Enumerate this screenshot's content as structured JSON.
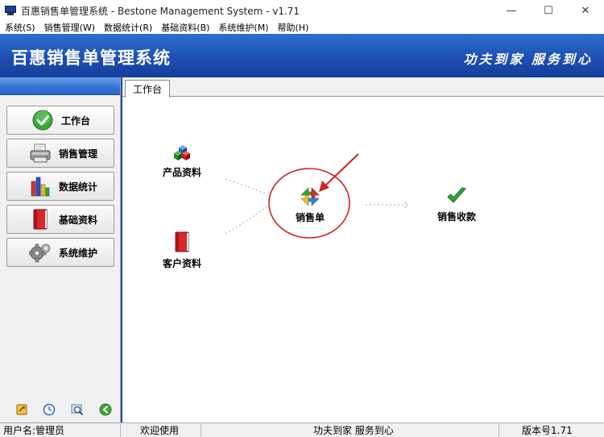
{
  "window": {
    "title": "百惠销售单管理系统 - Bestone Management System - v1.71",
    "minimize": "—",
    "maximize": "☐",
    "close": "✕"
  },
  "menu": [
    {
      "label": "系统(S)"
    },
    {
      "label": "销售管理(W)"
    },
    {
      "label": "数据统计(R)"
    },
    {
      "label": "基础资料(B)"
    },
    {
      "label": "系统维护(M)"
    },
    {
      "label": "帮助(H)"
    }
  ],
  "banner": {
    "title": "百惠销售单管理系统",
    "slogan": "功夫到家 服务到心"
  },
  "sidebar": {
    "items": [
      {
        "label": "工作台",
        "icon": "check-icon",
        "active": true
      },
      {
        "label": "销售管理",
        "icon": "printer-icon"
      },
      {
        "label": "数据统计",
        "icon": "bar-chart-icon"
      },
      {
        "label": "基础资料",
        "icon": "book-icon"
      },
      {
        "label": "系统维护",
        "icon": "gear-icon"
      }
    ],
    "tools": [
      "password-icon",
      "clock-icon",
      "search-icon",
      "back-icon"
    ]
  },
  "workarea": {
    "tab": "工作台",
    "nodes": {
      "product": "产品资料",
      "customer": "客户资料",
      "sales_order": "销售单",
      "collection": "销售收款"
    }
  },
  "status": {
    "user": "用户名:管理员",
    "welcome": "欢迎使用",
    "slogan": "功夫到家 服务到心",
    "version": "版本号1.71"
  },
  "colors": {
    "banner": "#1d4fb3",
    "annotation": "#d42020",
    "check": "#2fa82f"
  }
}
